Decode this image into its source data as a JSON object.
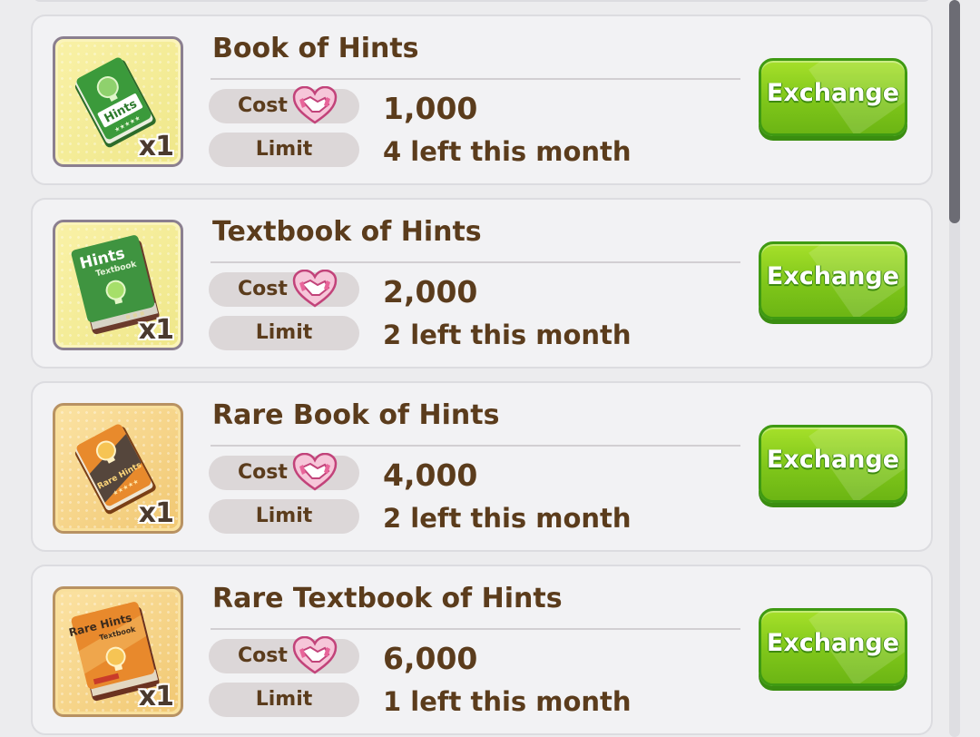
{
  "items": [
    {
      "title": "Book of Hints",
      "quantity": "x1",
      "icon": "green-hints-book-icon",
      "cost_label": "Cost",
      "cost_currency_icon": "handshake-heart-icon",
      "cost": "1,000",
      "limit_label": "Limit",
      "limit": "4 left this month",
      "button_label": "Exchange"
    },
    {
      "title": "Textbook of Hints",
      "quantity": "x1",
      "icon": "green-hints-textbook-icon",
      "cost_label": "Cost",
      "cost_currency_icon": "handshake-heart-icon",
      "cost": "2,000",
      "limit_label": "Limit",
      "limit": "2 left this month",
      "button_label": "Exchange"
    },
    {
      "title": "Rare Book of Hints",
      "quantity": "x1",
      "icon": "orange-rare-hints-book-icon",
      "cost_label": "Cost",
      "cost_currency_icon": "handshake-heart-icon",
      "cost": "4,000",
      "limit_label": "Limit",
      "limit": "2 left this month",
      "button_label": "Exchange"
    },
    {
      "title": "Rare Textbook of Hints",
      "quantity": "x1",
      "icon": "orange-rare-hints-textbook-icon",
      "cost_label": "Cost",
      "cost_currency_icon": "handshake-heart-icon",
      "cost": "6,000",
      "limit_label": "Limit",
      "limit": "1 left this month",
      "button_label": "Exchange"
    }
  ],
  "book_art": {
    "book_label": "Hints",
    "textbook_label": "Textbook",
    "rare_label": "Rare Hints",
    "stars": "★★★★★"
  },
  "colors": {
    "button_green": "#7fc61a",
    "title_brown": "#5b3c1c",
    "card_bg": "#f2f2f4",
    "currency_pink": "#e8659a"
  }
}
